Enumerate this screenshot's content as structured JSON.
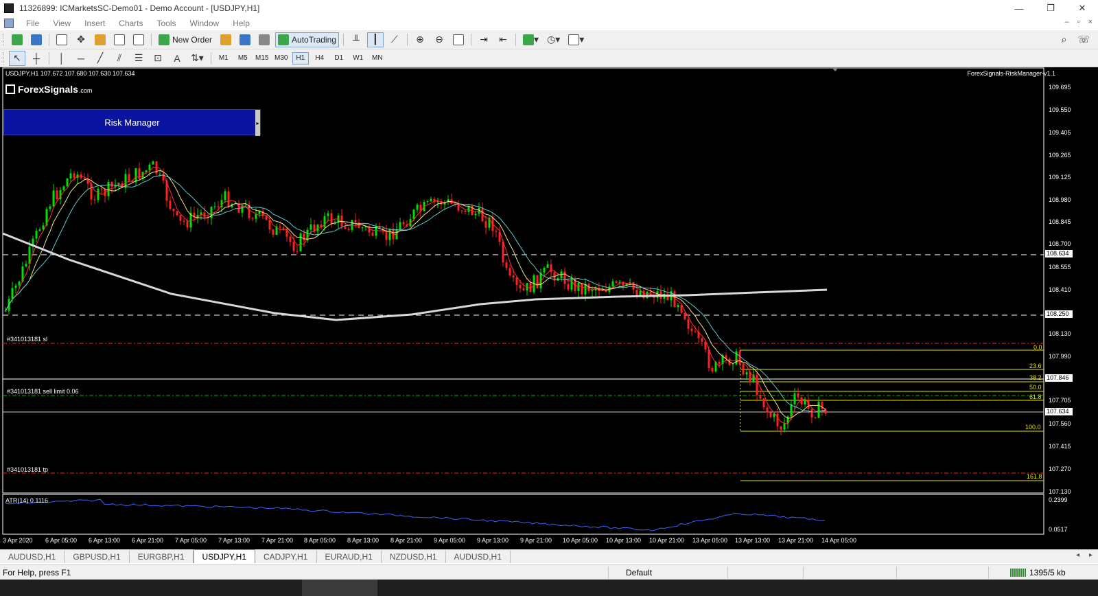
{
  "window": {
    "title": "11326899: ICMarketsSC-Demo01 - Demo Account - [USDJPY,H1]",
    "minimize": "—",
    "maximize": "❐",
    "close": "✕"
  },
  "menu": {
    "items": [
      "File",
      "View",
      "Insert",
      "Charts",
      "Tools",
      "Window",
      "Help"
    ],
    "mdi_min": "–",
    "mdi_restore": "▫",
    "mdi_close": "×"
  },
  "toolbar": {
    "new_order_label": "New Order",
    "autotrading_label": "AutoTrading"
  },
  "timeframes": [
    "M1",
    "M5",
    "M15",
    "M30",
    "H1",
    "H4",
    "D1",
    "W1",
    "MN"
  ],
  "active_timeframe": "H1",
  "chart": {
    "ohlc_label": "USDJPY,H1  107.672 107.680 107.630 107.634",
    "indicator_title": "ForexSignals-RiskManager-v1.1",
    "logo_text": "ForexSignals",
    "logo_suffix": ".com",
    "risk_manager_label": "Risk Manager",
    "risk_manager_toggle": "▸",
    "order_labels": {
      "sl": "#341013181 sl",
      "sell_limit": "#341013181 sell limit 0.06",
      "tp": "#341013181 tp"
    },
    "fib_levels": [
      "0.0",
      "23.6",
      "38.2",
      "50.0",
      "61.8",
      "100.0",
      "161.8"
    ],
    "price_scale": [
      "109.695",
      "109.550",
      "109.405",
      "109.265",
      "109.125",
      "108.980",
      "108.845",
      "108.700",
      "108.555",
      "108.410",
      "108.130",
      "107.990",
      "107.705",
      "107.560",
      "107.415",
      "107.270",
      "107.130"
    ],
    "price_boxes": {
      "upper_line": "108.634",
      "lower_line": "108.250",
      "sell_limit": "107.846",
      "bid": "107.634"
    },
    "atr_label": "ATR(14) 0.1116",
    "atr_scale": [
      "0.2399",
      "0.0517"
    ],
    "date_labels": [
      "3 Apr 2020",
      "6 Apr 05:00",
      "6 Apr 13:00",
      "6 Apr 21:00",
      "7 Apr 05:00",
      "7 Apr 13:00",
      "7 Apr 21:00",
      "8 Apr 05:00",
      "8 Apr 13:00",
      "8 Apr 21:00",
      "9 Apr 05:00",
      "9 Apr 13:00",
      "9 Apr 21:00",
      "10 Apr 05:00",
      "10 Apr 13:00",
      "10 Apr 21:00",
      "13 Apr 05:00",
      "13 Apr 13:00",
      "13 Apr 21:00",
      "14 Apr 05:00"
    ],
    "colors": {
      "background": "#000000",
      "bull": "#00e000",
      "bear": "#ff2020",
      "ma_fast": "#ff3030",
      "ma_mid": "#f0e68c",
      "ma_slow": "#5ec8c8",
      "ma_long": "#d8d8d8",
      "atr": "#4060ff",
      "fib": "#e6e600"
    }
  },
  "symbol_tabs": [
    "AUDUSD,H1",
    "GBPUSD,H1",
    "EURGBP,H1",
    "USDJPY,H1",
    "CADJPY,H1",
    "EURAUD,H1",
    "NZDUSD,H1",
    "AUDUSD,H1"
  ],
  "active_tab": "USDJPY,H1",
  "tab_scroll": {
    "left": "◂",
    "right": "▸"
  },
  "status": {
    "help": "For Help, press F1",
    "profile": "Default",
    "traffic": "1395/5 kb"
  }
}
